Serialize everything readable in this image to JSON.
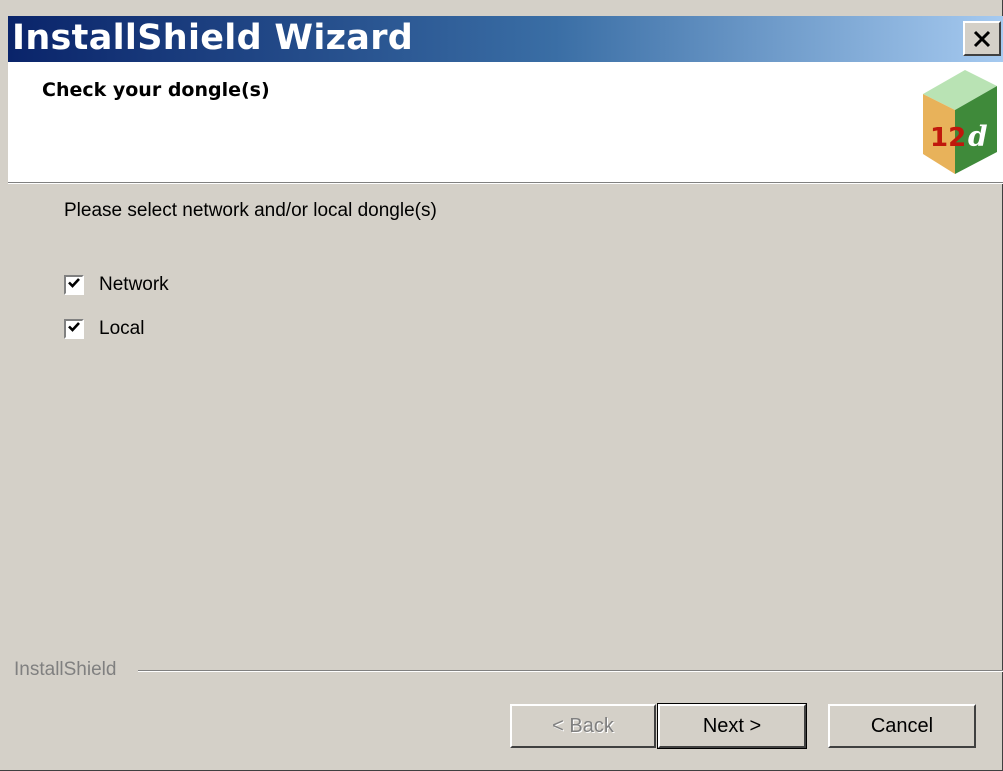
{
  "window": {
    "title": "InstallShield Wizard",
    "close_icon": "close-icon"
  },
  "header": {
    "title": "Check your dongle(s)",
    "logo_text_left": "12",
    "logo_text_right": "d"
  },
  "body": {
    "prompt": "Please select network and/or local dongle(s)",
    "options": [
      {
        "label": "Network",
        "checked": true
      },
      {
        "label": "Local",
        "checked": true
      }
    ]
  },
  "footer": {
    "brand": "InstallShield",
    "back_label": "< Back",
    "next_label": "Next >",
    "cancel_label": "Cancel"
  },
  "colors": {
    "title_gradient_start": "#0a246a",
    "title_gradient_end": "#a6caf0",
    "face": "#d4d0c8"
  }
}
